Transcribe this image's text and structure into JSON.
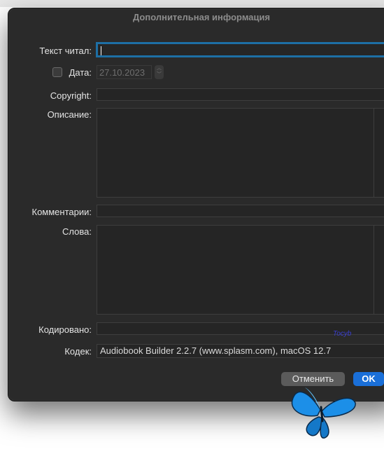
{
  "dialog": {
    "title": "Дополнительная информация"
  },
  "fields": {
    "narrator_label": "Текст читал:",
    "narrator_value": "",
    "date_label": "Дата:",
    "date_value": "27.10.2023",
    "date_checked": false,
    "copyright_label": "Copyright:",
    "copyright_value": "",
    "description_label": "Описание:",
    "comments_label": "Комментарии:",
    "comments_value": "",
    "lyrics_label": "Слова:",
    "encoded_label": "Кодировано:",
    "encoded_value": "",
    "codec_label": "Кодек:",
    "codec_value": "Audiobook Builder 2.2.7 (www.splasm.com), macOS 12.7"
  },
  "buttons": {
    "cancel_label": "Отменить",
    "ok_label": "OK"
  },
  "overlay": {
    "watermark_text": "Tocyb",
    "butterfly_icon": "butterfly-icon"
  },
  "colors": {
    "accent": "#1a6fd8",
    "focus_ring": "#1d6fa5",
    "dialog_bg": "#2a2a2a"
  }
}
